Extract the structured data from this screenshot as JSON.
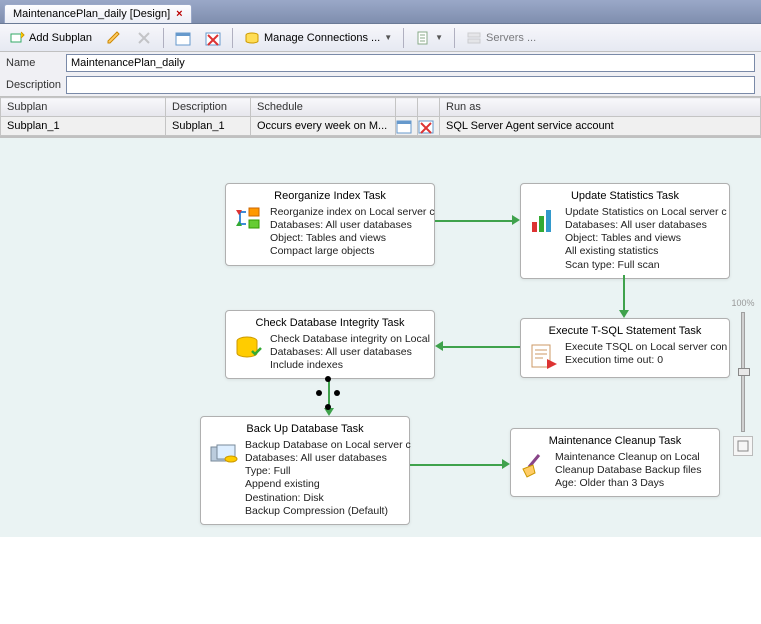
{
  "tab": {
    "title": "MaintenancePlan_daily [Design]"
  },
  "toolbar": {
    "add_subplan": "Add Subplan",
    "manage_conn": "Manage Connections ...",
    "servers": "Servers ..."
  },
  "form": {
    "name_label": "Name",
    "name_value": "MaintenancePlan_daily",
    "desc_label": "Description",
    "desc_value": ""
  },
  "grid": {
    "headers": {
      "subplan": "Subplan",
      "description": "Description",
      "schedule": "Schedule",
      "runas": "Run as"
    },
    "row": {
      "subplan": "Subplan_1",
      "description": "Subplan_1",
      "schedule": "Occurs every week on M...",
      "runas": "SQL Server Agent service account"
    }
  },
  "nodes": {
    "reorg": {
      "title": "Reorganize Index Task",
      "lines": [
        "Reorganize index on Local server c",
        "Databases: All user databases",
        "Object: Tables and views",
        "Compact large objects"
      ]
    },
    "stats": {
      "title": "Update Statistics Task",
      "lines": [
        "Update Statistics on Local server c",
        "Databases: All user databases",
        "Object: Tables and views",
        "All existing statistics",
        "Scan type: Full scan"
      ]
    },
    "tsql": {
      "title": "Execute T-SQL Statement Task",
      "lines": [
        "Execute TSQL on Local server con",
        "Execution time out: 0"
      ]
    },
    "integrity": {
      "title": "Check Database Integrity Task",
      "lines": [
        "Check Database integrity on Local",
        "Databases: All user databases",
        "Include indexes"
      ]
    },
    "backup": {
      "title": "Back Up Database Task",
      "lines": [
        "Backup Database on Local server c",
        "Databases: All user databases",
        "Type: Full",
        "Append existing",
        "Destination: Disk",
        "Backup Compression (Default)"
      ]
    },
    "cleanup": {
      "title": "Maintenance Cleanup Task",
      "lines": [
        "Maintenance Cleanup on Local",
        "Cleanup Database Backup files",
        "Age: Older than 3 Days"
      ]
    }
  },
  "zoom": {
    "label": "100%"
  }
}
